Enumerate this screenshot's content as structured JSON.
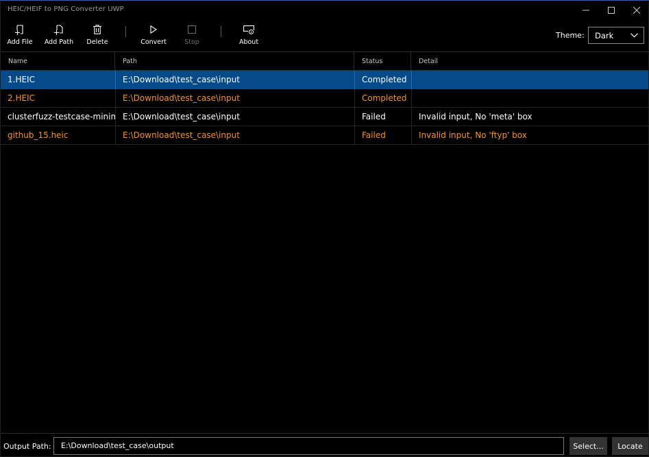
{
  "window": {
    "title": "HEIC/HEIF to PNG Converter UWP"
  },
  "toolbar": {
    "add_file": "Add File",
    "add_path": "Add Path",
    "delete": "Delete",
    "convert": "Convert",
    "stop": "Stop",
    "about": "About",
    "theme_label": "Theme:",
    "theme_value": "Dark"
  },
  "table": {
    "columns": {
      "name": "Name",
      "path": "Path",
      "status": "Status",
      "detail": "Detail"
    },
    "rows": [
      {
        "name": "1.HEIC",
        "path": "E:\\Download\\test_case\\input",
        "status": "Completed",
        "detail": ""
      },
      {
        "name": "2.HEIC",
        "path": "E:\\Download\\test_case\\input",
        "status": "Completed",
        "detail": ""
      },
      {
        "name": "clusterfuzz-testcase-minim",
        "path": "E:\\Download\\test_case\\input",
        "status": "Failed",
        "detail": "Invalid input, No 'meta' box"
      },
      {
        "name": "github_15.heic",
        "path": "E:\\Download\\test_case\\input",
        "status": "Failed",
        "detail": "Invalid input, No 'ftyp' box"
      }
    ]
  },
  "bottom": {
    "output_label": "Output Path:",
    "output_value": "E:\\Download\\test_case\\output",
    "select_label": "Select...",
    "locate_label": "Locate"
  },
  "colors": {
    "selected_row": "#074a89",
    "accent_text": "#f7941d",
    "normal_text": "#ffffff"
  },
  "icons": [
    "add-file-icon",
    "add-path-icon",
    "delete-icon",
    "play-icon",
    "stop-icon",
    "about-icon",
    "chevron-down-icon",
    "minimize-icon",
    "maximize-icon",
    "close-icon"
  ]
}
